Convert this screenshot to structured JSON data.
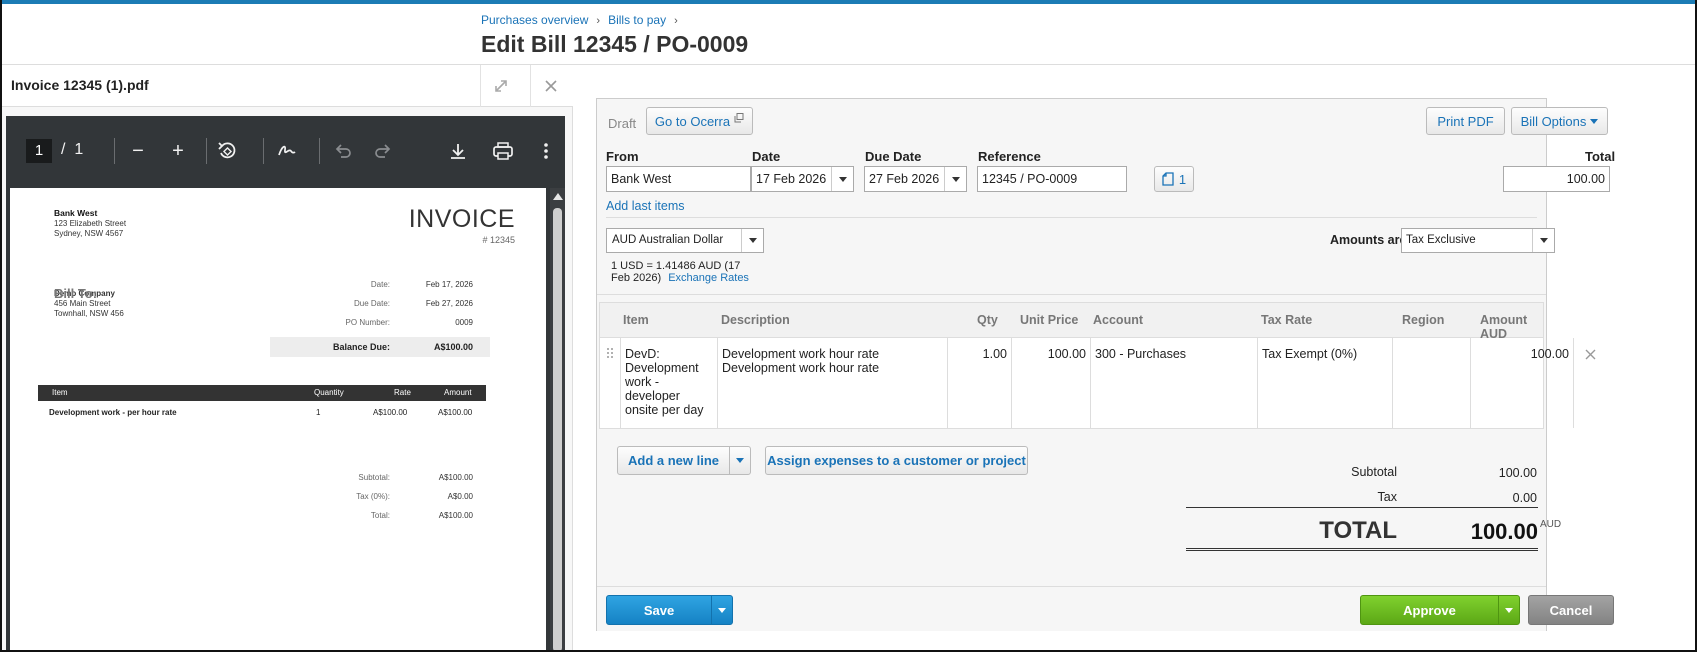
{
  "breadcrumb": {
    "items": [
      "Purchases overview",
      "Bills to pay"
    ],
    "separator": "›"
  },
  "page": {
    "title": "Edit Bill 12345 / PO-0009"
  },
  "pdf_pane": {
    "filename": "Invoice 12345 (1).pdf",
    "viewer": {
      "page_current": "1",
      "page_separator": "/",
      "page_total": "1"
    },
    "invoice": {
      "from_name": "Bank West",
      "from_line1": "123 Elizabeth Street",
      "from_line2": "Sydney, NSW 4567",
      "heading": "INVOICE",
      "number": "# 12345",
      "bill_to_label": "Bill To:",
      "to_name": "Demo Company",
      "to_line1": "456 Main Street",
      "to_line2": "Townhall, NSW 456",
      "meta": [
        {
          "k": "Date:",
          "v": "Feb 17, 2026"
        },
        {
          "k": "Due Date:",
          "v": "Feb 27, 2026"
        },
        {
          "k": "PO Number:",
          "v": "0009"
        }
      ],
      "balance_label": "Balance Due:",
      "balance_value": "A$100.00",
      "table_headers": [
        "Item",
        "Quantity",
        "Rate",
        "Amount"
      ],
      "row": {
        "item": "Development work - per hour rate",
        "qty": "1",
        "rate": "A$100.00",
        "amount": "A$100.00"
      },
      "totals": [
        {
          "k": "Subtotal:",
          "v": "A$100.00"
        },
        {
          "k": "Tax (0%):",
          "v": "A$0.00"
        },
        {
          "k": "Total:",
          "v": "A$100.00"
        }
      ]
    }
  },
  "bill": {
    "status": "Draft",
    "go_to_ocerra": "Go to Ocerra",
    "print_pdf": "Print PDF",
    "bill_options": "Bill Options",
    "labels": {
      "from": "From",
      "date": "Date",
      "due_date": "Due Date",
      "reference": "Reference",
      "total": "Total"
    },
    "from": "Bank West",
    "date": "17 Feb 2026",
    "due_date": "27 Feb 2026",
    "reference": "12345 / PO-0009",
    "attachments_count": "1",
    "total": "100.00",
    "add_last_items": "Add last items",
    "currency": "AUD Australian Dollar",
    "amounts_are_label": "Amounts are",
    "amounts_are": "Tax Exclusive",
    "exchange_line1": "1 USD = 1.41486  AUD  (17",
    "exchange_line2": "Feb 2026)",
    "exchange_rates_link": "Exchange Rates",
    "columns": [
      "Item",
      "Description",
      "Qty",
      "Unit Price",
      "Account",
      "Tax Rate",
      "Region",
      "Amount AUD"
    ],
    "line": {
      "item_lines": [
        "DevD:",
        "Development",
        "work -",
        "developer",
        "onsite per day"
      ],
      "desc_lines": [
        "Development work hour rate",
        "Development work hour rate"
      ],
      "qty": "1.00",
      "unit_price": "100.00",
      "account": "300 - Purchases",
      "tax_rate": "Tax Exempt (0%)",
      "region": "",
      "amount": "100.00"
    },
    "add_new_line": "Add a new line",
    "assign_expenses": "Assign expenses to a customer or project",
    "subtotal_label": "Subtotal",
    "subtotal": "100.00",
    "tax_label": "Tax",
    "tax": "0.00",
    "grand_total_label": "TOTAL",
    "grand_total": "100.00",
    "currency_code": "AUD",
    "save": "Save",
    "approve": "Approve",
    "cancel": "Cancel"
  },
  "colors": {
    "accent": "#1a73b7",
    "save": "#1a8fd1",
    "approve": "#6bbd1e",
    "cancel": "#8e8e8e"
  }
}
